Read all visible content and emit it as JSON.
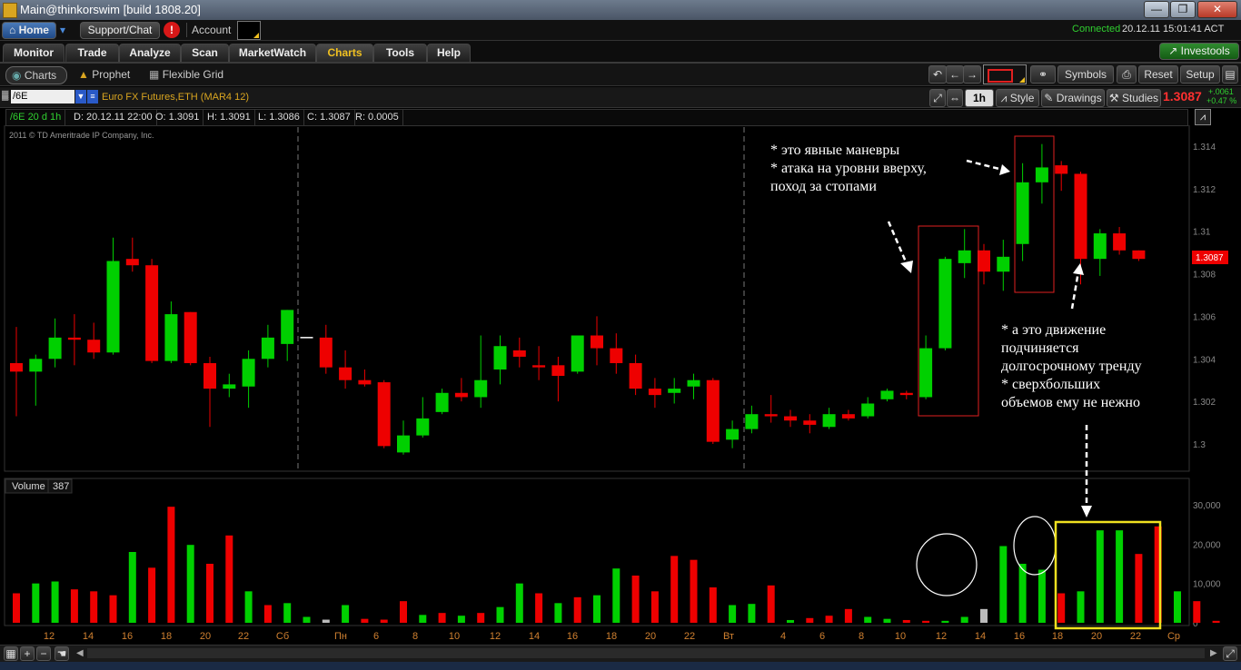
{
  "window": {
    "title": "Main@thinkorswim [build 1808.20]",
    "min": "—",
    "max": "❐",
    "close": "✕"
  },
  "topbar": {
    "home": "Home",
    "support": "Support/Chat",
    "alert": "!",
    "account_label": "Account",
    "status_connected": "Connected",
    "status_time": "20.12.11 15:01:41 ACT",
    "investools": "Investools"
  },
  "tabs": [
    "Monitor",
    "Trade",
    "Analyze",
    "Scan",
    "MarketWatch",
    "Charts",
    "Tools",
    "Help"
  ],
  "subtabs": {
    "charts": "Charts",
    "prophet": "Prophet",
    "flexible_grid": "Flexible Grid"
  },
  "toolbar": {
    "symbols": "Symbols",
    "reset": "Reset",
    "setup": "Setup",
    "undo": "↶",
    "back": "←",
    "forward": "→"
  },
  "chart_header": {
    "symbol": "/6E",
    "description": "Euro FX Futures,ETH (MAR4 12)",
    "period": "1h",
    "style": "Style",
    "drawings": "Drawings",
    "studies": "Studies",
    "last": "1.3087",
    "change": "+.0061",
    "change_pct": "+0.47 %"
  },
  "info": {
    "agg": "/6E 20 d 1h",
    "date": "D: 20.12.11 22:00",
    "open": "O: 1.3091",
    "high": "H: 1.3091",
    "low": "L: 1.3086",
    "close": "C: 1.3087",
    "range": "R: 0.0005"
  },
  "copyright": "2011 © TD Ameritrade IP Company, Inc.",
  "price_tag": "1.3087",
  "volume_label": "Volume",
  "volume_value": "387",
  "annotations": {
    "a1": [
      "* это явные маневры",
      "* атака на уровни вверху,",
      "поход за стопами"
    ],
    "a2": [
      "* а это движение",
      "подчиняется",
      "долгосрочному тренду",
      "* сверхбольших",
      "объемов ему не нежно"
    ]
  },
  "colors": {
    "up": "#00d000",
    "down": "#ee0000",
    "neutral": "#bbbbbb",
    "bg": "#000000",
    "grid_axis": "#888888",
    "accent": "#f0c020"
  },
  "chart_data": [
    {
      "type": "candlestick",
      "title": "",
      "ylim": [
        1.2995,
        1.3155
      ],
      "y_ticks": [
        "1.3",
        "1.302",
        "1.304",
        "1.306",
        "1.308",
        "1.31",
        "1.312",
        "1.314"
      ],
      "x_ticks": [
        "12",
        "14",
        "16",
        "18",
        "20",
        "22",
        "Сб",
        "Пн",
        "6",
        "8",
        "10",
        "12",
        "14",
        "16",
        "18",
        "20",
        "22",
        "Вт",
        "4",
        "6",
        "8",
        "10",
        "12",
        "14",
        "16",
        "18",
        "20",
        "22",
        "Ср"
      ],
      "candles": [
        [
          1.3038,
          1.3055,
          1.3013,
          1.3034
        ],
        [
          1.3034,
          1.3042,
          1.3018,
          1.304
        ],
        [
          1.304,
          1.3059,
          1.3036,
          1.305
        ],
        [
          1.305,
          1.3061,
          1.3037,
          1.3049
        ],
        [
          1.3049,
          1.3057,
          1.304,
          1.3043
        ],
        [
          1.3043,
          1.3097,
          1.3042,
          1.3086
        ],
        [
          1.3087,
          1.3097,
          1.3081,
          1.3084
        ],
        [
          1.3084,
          1.3087,
          1.3038,
          1.3039
        ],
        [
          1.3039,
          1.3067,
          1.3038,
          1.3061
        ],
        [
          1.3062,
          1.3062,
          1.3037,
          1.3038
        ],
        [
          1.3038,
          1.3041,
          1.3008,
          1.3026
        ],
        [
          1.3026,
          1.3033,
          1.3022,
          1.3028
        ],
        [
          1.3027,
          1.3044,
          1.3017,
          1.304
        ],
        [
          1.304,
          1.3056,
          1.3036,
          1.305
        ],
        [
          1.3047,
          1.3063,
          1.3039,
          1.3063
        ],
        [
          1.305,
          1.305,
          1.305,
          1.305
        ],
        [
          1.305,
          1.3056,
          1.3033,
          1.3036
        ],
        [
          1.3036,
          1.3044,
          1.3026,
          1.303
        ],
        [
          1.303,
          1.3035,
          1.3027,
          1.3028
        ],
        [
          1.3029,
          1.303,
          1.2998,
          1.2999
        ],
        [
          1.2996,
          1.3011,
          1.2995,
          1.3004
        ],
        [
          1.3004,
          1.3022,
          1.3003,
          1.3012
        ],
        [
          1.3015,
          1.3026,
          1.3014,
          1.3024
        ],
        [
          1.3024,
          1.3031,
          1.302,
          1.3022
        ],
        [
          1.3022,
          1.3051,
          1.3017,
          1.303
        ],
        [
          1.3035,
          1.3051,
          1.3028,
          1.3046
        ],
        [
          1.3044,
          1.305,
          1.3036,
          1.3041
        ],
        [
          1.3037,
          1.3046,
          1.303,
          1.3036
        ],
        [
          1.3037,
          1.3041,
          1.302,
          1.3032
        ],
        [
          1.3034,
          1.3048,
          1.3033,
          1.3051
        ],
        [
          1.3051,
          1.306,
          1.3037,
          1.3045
        ],
        [
          1.3045,
          1.3052,
          1.3033,
          1.3038
        ],
        [
          1.3038,
          1.3042,
          1.3023,
          1.3026
        ],
        [
          1.3026,
          1.3031,
          1.3017,
          1.3023
        ],
        [
          1.3024,
          1.3031,
          1.3019,
          1.3026
        ],
        [
          1.3027,
          1.3033,
          1.3021,
          1.303
        ],
        [
          1.303,
          1.3031,
          1.3,
          1.3001
        ],
        [
          1.3002,
          1.3011,
          1.2998,
          1.3007
        ],
        [
          1.3007,
          1.3018,
          1.3005,
          1.3014
        ],
        [
          1.3014,
          1.3023,
          1.301,
          1.3013
        ],
        [
          1.3013,
          1.3016,
          1.3008,
          1.3011
        ],
        [
          1.3011,
          1.3014,
          1.3005,
          1.3009
        ],
        [
          1.3008,
          1.3017,
          1.3007,
          1.3014
        ],
        [
          1.3014,
          1.3016,
          1.3011,
          1.3012
        ],
        [
          1.3013,
          1.3022,
          1.3012,
          1.3019
        ],
        [
          1.3021,
          1.3026,
          1.302,
          1.3025
        ],
        [
          1.3024,
          1.3025,
          1.3021,
          1.3023
        ],
        [
          1.3022,
          1.3051,
          1.3021,
          1.3045
        ],
        [
          1.3045,
          1.3088,
          1.3044,
          1.3087
        ],
        [
          1.3085,
          1.3101,
          1.3078,
          1.3091
        ],
        [
          1.3091,
          1.3094,
          1.3075,
          1.3081
        ],
        [
          1.3081,
          1.3096,
          1.3072,
          1.3088
        ],
        [
          1.3094,
          1.3132,
          1.3086,
          1.3123
        ],
        [
          1.3123,
          1.3141,
          1.3113,
          1.313
        ],
        [
          1.3131,
          1.3133,
          1.3119,
          1.3127
        ],
        [
          1.3127,
          1.3128,
          1.3075,
          1.3087
        ],
        [
          1.3087,
          1.3101,
          1.3079,
          1.3099
        ],
        [
          1.3099,
          1.3102,
          1.3089,
          1.3091
        ],
        [
          1.3091,
          1.3091,
          1.3086,
          1.3087
        ]
      ]
    },
    {
      "type": "bar",
      "title": "Volume",
      "ylim": [
        0,
        32000
      ],
      "y_ticks": [
        "30,000",
        "20,000",
        "10,000",
        "0"
      ],
      "values": [
        7500,
        10000,
        10500,
        8500,
        8000,
        7000,
        18000,
        14000,
        29500,
        19800,
        15000,
        22200,
        8000,
        4500,
        5000,
        1500,
        800,
        4500,
        1000,
        800,
        5500,
        2000,
        2500,
        1800,
        2500,
        4000,
        10000,
        7500,
        5000,
        6500,
        7000,
        13800,
        12000,
        8000,
        17000,
        16000,
        9000,
        4500,
        4800,
        9500,
        700,
        1200,
        1800,
        3500,
        1500,
        1000,
        700,
        500,
        500,
        1500,
        3500,
        19500,
        15000,
        13500,
        7500,
        8000,
        23500,
        23500,
        17500,
        24500,
        8000,
        5500,
        500
      ],
      "colors": [
        "r",
        "g",
        "g",
        "r",
        "r",
        "r",
        "g",
        "r",
        "r",
        "g",
        "r",
        "r",
        "g",
        "r",
        "g",
        "g",
        "n",
        "g",
        "r",
        "r",
        "r",
        "g",
        "r",
        "g",
        "r",
        "g",
        "g",
        "r",
        "g",
        "r",
        "g",
        "g",
        "r",
        "r",
        "r",
        "r",
        "r",
        "g",
        "g",
        "r",
        "g",
        "r",
        "r",
        "r",
        "g",
        "g",
        "r",
        "r",
        "g",
        "g",
        "n",
        "g",
        "g",
        "g",
        "r",
        "g",
        "g",
        "g",
        "r",
        "r",
        "g",
        "r",
        "r"
      ]
    }
  ]
}
